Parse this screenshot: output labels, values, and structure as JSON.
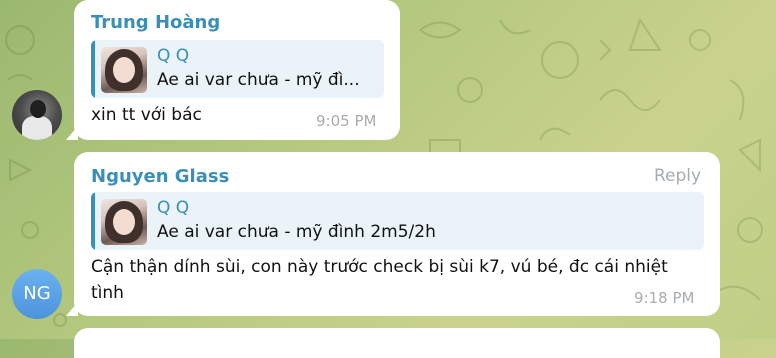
{
  "messages": [
    {
      "sender": "Trung Hoàng",
      "quote": {
        "name": "Q Q",
        "text": "Ae ai var chưa - mỹ đì..."
      },
      "text": "xin tt với bác",
      "time": "9:05 PM"
    },
    {
      "sender": "Nguyen Glass",
      "reply_label": "Reply",
      "quote": {
        "name": "Q Q",
        "text": "Ae ai var chưa - mỹ đình 2m5/2h"
      },
      "text": "Cận thận dính sùi, con này trước check bị sùi k7, vú bé, đc cái nhiệt tình",
      "time": "9:18 PM",
      "avatar_initials": "NG"
    }
  ],
  "colors": {
    "accent": "#3a8fb7",
    "quote_background": "#e9f3f8",
    "timestamp": "#a7acb1",
    "avatar_gradient": "#4c93dc"
  }
}
